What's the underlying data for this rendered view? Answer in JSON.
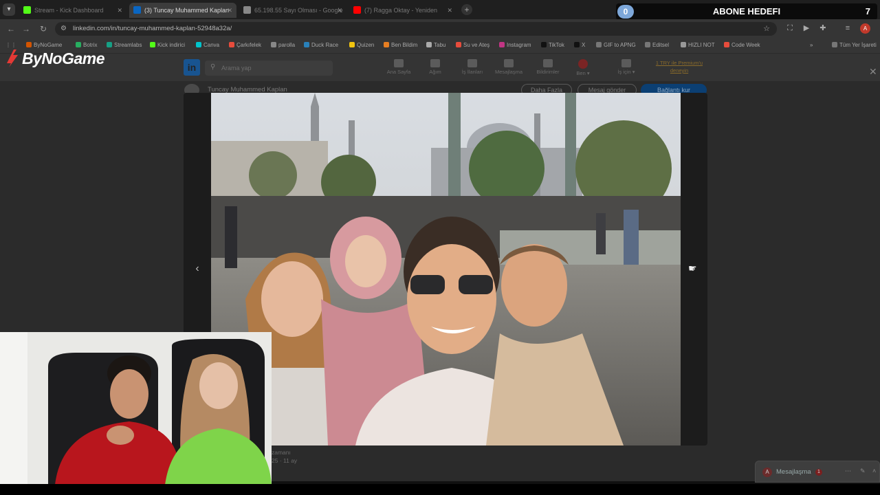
{
  "browser": {
    "tabs": [
      {
        "label": "Stream - Kick Dashboard",
        "favicon_color": "#53fc18",
        "active": false
      },
      {
        "label": "(3) Tuncay Muhammed Kaplan",
        "favicon_color": "#0a66c2",
        "active": true
      },
      {
        "label": "65.198.55 Sayı Olması - Google",
        "favicon_color": "#888888",
        "active": false
      },
      {
        "label": "(7) Ragga Oktay - Yeniden",
        "favicon_color": "#ff0000",
        "active": false
      }
    ],
    "url": "linkedin.com/in/tuncay-muhammed-kaplan-52948a32a/",
    "profile_initial": "A",
    "bookmarks": [
      {
        "label": "ByNoGame",
        "color": "#d35400"
      },
      {
        "label": "Botrix",
        "color": "#27ae60"
      },
      {
        "label": "Streamlabs",
        "color": "#16a085"
      },
      {
        "label": "Kick indirici",
        "color": "#53fc18"
      },
      {
        "label": "Canva",
        "color": "#00c4cc"
      },
      {
        "label": "Çarkıfelek",
        "color": "#e74c3c"
      },
      {
        "label": "parolla",
        "color": "#888888"
      },
      {
        "label": "Duck Race",
        "color": "#2980b9"
      },
      {
        "label": "Quizen",
        "color": "#f1c40f"
      },
      {
        "label": "Ben Bildim",
        "color": "#e67e22"
      },
      {
        "label": "Tabu",
        "color": "#aaaaaa"
      },
      {
        "label": "Su ve Ateş",
        "color": "#e74c3c"
      },
      {
        "label": "Instagram",
        "color": "#c13584"
      },
      {
        "label": "TikTok",
        "color": "#111111"
      },
      {
        "label": "X",
        "color": "#111111"
      },
      {
        "label": "GIF to APNG",
        "color": "#777777"
      },
      {
        "label": "Editsel",
        "color": "#777777"
      },
      {
        "label": "HIZLI NOT",
        "color": "#999999"
      },
      {
        "label": "Code Week",
        "color": "#e74c3c"
      }
    ],
    "bookmarks_more": "»",
    "all_bookmarks": "Tüm Yer İşareti"
  },
  "goal_overlay": {
    "current": "0",
    "label": "ABONE HEDEFI",
    "target": "7"
  },
  "brand": {
    "name": "ByNoGame"
  },
  "linkedin": {
    "search_placeholder": "Arama yap",
    "nav_items": [
      {
        "label": "Ana Sayfa"
      },
      {
        "label": "Ağım"
      },
      {
        "label": "İş İlanları"
      },
      {
        "label": "Mesajlaşma"
      },
      {
        "label": "Bildirimler"
      },
      {
        "label": "Ben ▾"
      },
      {
        "label": "İş için ▾"
      }
    ],
    "premium_text": "1 TRY ile Premium'u deneyin",
    "profile_name": "Tuncay Muhammed Kaplan",
    "buttons": {
      "more": "Daha Fazla",
      "message": "Mesaj gönder",
      "connect": "Bağlantı kur"
    },
    "post_meta_line1": "zamanı",
    "post_meta_line2": "25 · 11 ay",
    "messaging_label": "Mesajlaşma",
    "messaging_badge": "1",
    "messaging_avatar": "A"
  },
  "lightbox": {
    "prev": "‹",
    "next": "›"
  }
}
